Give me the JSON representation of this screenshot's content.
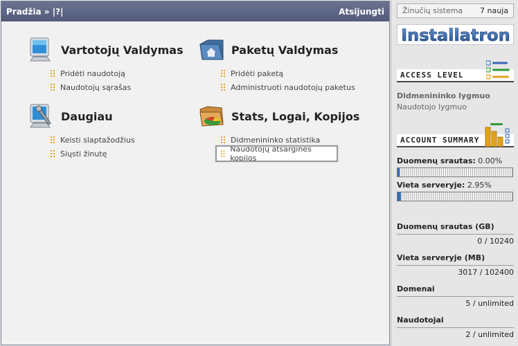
{
  "topbar": {
    "home": "Pradžia",
    "separator": " » ",
    "help": "|?|",
    "logout": "Atsijungti"
  },
  "sections": {
    "users": {
      "title": "Vartotojų Valdymas",
      "icon": "monitor-icon",
      "links": [
        "Pridėti naudotoją",
        "Naudotojų sąrašas"
      ]
    },
    "packages": {
      "title": "Paketų Valdymas",
      "icon": "home-folder-icon",
      "links": [
        "Pridėti paketą",
        "Administruoti naudotojų paketus"
      ]
    },
    "more": {
      "title": "Daugiau",
      "icon": "wrench-monitor-icon",
      "links": [
        "Keisti slaptažodžius",
        "Siųsti žinutę"
      ]
    },
    "stats": {
      "title": "Stats, Logai, Kopijos",
      "icon": "pie-chart-folder-icon",
      "links": [
        "Didmenininko statistika",
        "Naudotojų atsarginės kopijos"
      ]
    }
  },
  "sidebar": {
    "messages": {
      "label": "Žinučių sistema",
      "count": "7 nauja"
    },
    "logo": "Installatron",
    "access_level": {
      "header": "ACCESS LEVEL",
      "levels": [
        "Didmenininko lygmuo",
        "Naudotojo lygmuo"
      ]
    },
    "account_summary": {
      "header": "ACCOUNT SUMMARY",
      "bandwidth": {
        "label": "Duomenų srautas:",
        "value": "0.00%",
        "percent": 0.0
      },
      "disk": {
        "label": "Vieta serveryje:",
        "value": "2.95%",
        "percent": 2.95
      }
    },
    "stats": [
      {
        "label": "Duomenų srautas (GB)",
        "value": "0 / 10240"
      },
      {
        "label": "Vieta serveryje (MB)",
        "value": "3017 / 102400"
      },
      {
        "label": "Domenai",
        "value": "5 / unlimited"
      },
      {
        "label": "Naudotojai",
        "value": "2 / unlimited"
      }
    ]
  },
  "colors": {
    "topbar": "#5d6585",
    "bullet": "#e3a21a",
    "bar_fill": "#2f6fb8"
  }
}
